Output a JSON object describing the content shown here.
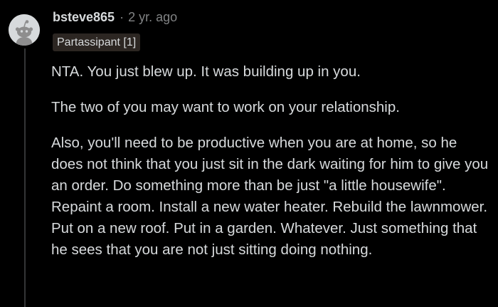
{
  "comment": {
    "author": "bsteve865",
    "separator": "·",
    "time": "2 yr. ago",
    "flair": "Partassipant [1]",
    "avatar_icon": "snoo-avatar-icon",
    "colors": {
      "background": "#000000",
      "text": "#d7dadc",
      "meta": "#818384",
      "flair_bg": "#2c2622",
      "thread_line": "#343536"
    },
    "paragraphs": [
      "NTA. You just blew up. It was building up in you.",
      "The two of you may want to work on your relationship.",
      "Also, you'll need to be productive when you are at home, so he does not think that you just sit in the dark waiting for him to give you an order. Do something more than be just \"a little housewife\". Repaint a room. Install a new water heater. Rebuild the lawnmower. Put on a new roof. Put in a garden. Whatever. Just something that he sees that you are not just sitting doing nothing."
    ]
  }
}
